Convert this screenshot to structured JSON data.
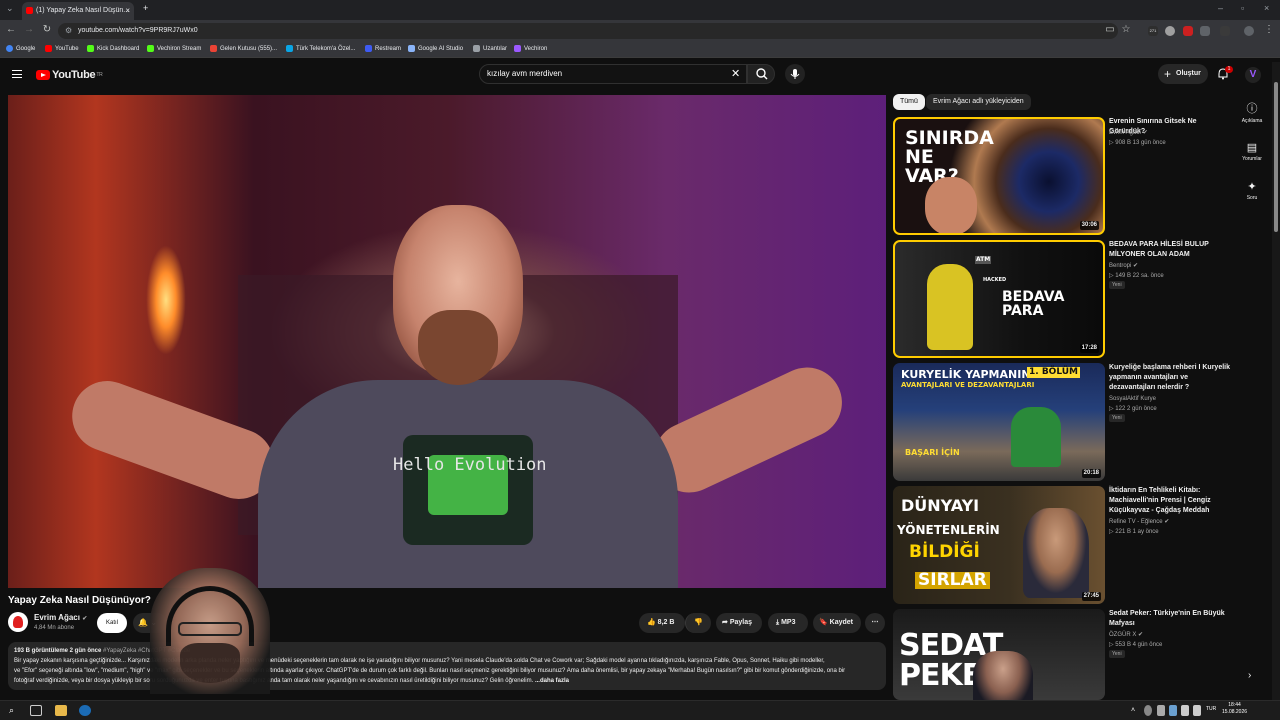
{
  "browser": {
    "tab_title": "(1) Yapay Zeka Nasıl Düşün...",
    "new_tab": "+",
    "url": "youtube.com/watch?v=9PR9RJ7uWx0",
    "ext_badge": "271",
    "bookmarks": [
      "Google",
      "YouTube",
      "Kick Dashboard",
      "Vechiron Stream",
      "Gelen Kutusu (555)...",
      "Türk Telekom'a Özel...",
      "Restream",
      "Google AI Studio",
      "Uzantılar",
      "Vechiron"
    ],
    "colors": {
      "accent": "#ff0000"
    }
  },
  "youtube": {
    "logo_text": "YouTube",
    "logo_region": "TR",
    "search_value": "kızılay avm merdiven",
    "create_label": "Oluştur",
    "notification_count": "1",
    "avatar_letter": "V"
  },
  "video": {
    "shirt_text": "Hello Evolution",
    "title": "Yapay Zeka Nasıl Düşünüyor?",
    "channel": "Evrim Ağacı",
    "subscribers": "4,84 Mn abone",
    "join_label": "Katıl",
    "likes": "8,2 B",
    "share_label": "Paylaş",
    "mp3_label": "MP3",
    "save_label": "Kaydet",
    "stats": "193 B görüntüleme  2 gün önce",
    "hashtag": "#YapayZeka #ChatGPT #Claude",
    "description_line1": "Bir yapay zekanın karşısına geçtiğinizde... Karşınızdaki modelin arka planda neler yaptığını ve menüdeki seçeneklerin tam olarak ne işe yaradığını biliyor musunuz? Yani mesela Claude'da solda Chat ve Cowork var; Sağdaki model ayarına tıkladığınızda, karşınıza Fable, Opus, Sonnet, Haiku gibi modeller,",
    "description_line2": "ve \"Efor\" seçeneği altında \"low\", \"medium\", \"high\" ve \"max\" gibi seçenekler ve bu seçeneklerin altında ayarlar çıkıyor. ChatGPT'de de durum çok farklı değil. Bunları nasıl seçmeniz gerektiğini biliyor musunuz? Ama daha önemlisi, bir yapay zekaya \"Merhaba! Bugün nasılsın?\" gibi bir komut gönderdiğinizde, ona bir",
    "description_line3": "fotoğraf verdiğinizde, veya bir dosya yükleyip bir soru sorduğunuzda ve enter tuşuna bastığınız anda tam olarak neler yaşandığını ve cevabınızın nasıl üretildiğini biliyor musunuz? Gelin öğrenelim.",
    "more_label": "...daha fazla"
  },
  "sidebar": {
    "chips": [
      "Tümü",
      "Evrim Ağacı adlı yükleyiciden"
    ],
    "items": [
      {
        "title": "Evrenin Sınırına Gitsek Ne Görürdük?",
        "channel": "Evrim Ağacı",
        "meta": "▷ 908 B   13 gün önce",
        "duration": "30:06",
        "thumb_text": "SINIRDA NE VAR?",
        "new_badge": ""
      },
      {
        "title": "BEDAVA PARA HİLESİ BULUP MİLYONER OLAN ADAM",
        "channel": "Bentropi",
        "meta": "▷ 149 B   22 sa. önce",
        "duration": "17:28",
        "thumb_text": "BEDAVA PARA",
        "thumb_text2": "ATM",
        "thumb_text3": "HACKED",
        "new_badge": "Yeni"
      },
      {
        "title": "Kuryeliğe başlama rehberi I Kuryelik yapmanın avantajları ve dezavantajları nelerdir ?",
        "channel": "SosyalAktif Kurye",
        "meta": "▷ 122   2 gün önce",
        "duration": "20:18",
        "thumb_text": "KURYELİK YAPMANIN",
        "thumb_text2": "AVANTAJLARI VE DEZAVANTAJLARI",
        "thumb_text3": "1. BÖLÜM",
        "thumb_text4": "BAŞARI İÇİN",
        "new_badge": "Yeni"
      },
      {
        "title": "İktidarın En Tehlikeli Kitabı: Machiavelli'nin Prensi | Cengiz Küçükayvaz - Çağdaş Meddah",
        "channel": "Refine TV - Eğlence",
        "meta": "▷ 221 B   1 ay önce",
        "duration": "27:45",
        "thumb_text": "DÜNYAYI",
        "thumb_text2": "YÖNETENLERİN",
        "thumb_text3": "BİLDİĞİ",
        "thumb_text4": "SIRLAR",
        "new_badge": ""
      },
      {
        "title": "Sedat Peker: Türkiye'nin En Büyük Mafyası",
        "channel": "ÖZGÜR X",
        "meta": "▷ 553 B   4 gün önce",
        "duration": "",
        "thumb_text": "SEDAT PEKER",
        "new_badge": "Yeni"
      }
    ]
  },
  "rail": {
    "description": "Açıklama",
    "comments": "Yorumlar",
    "ask": "Soru"
  },
  "taskbar": {
    "lang": "TUR",
    "time": "18:44",
    "date": "15.08.2026"
  }
}
